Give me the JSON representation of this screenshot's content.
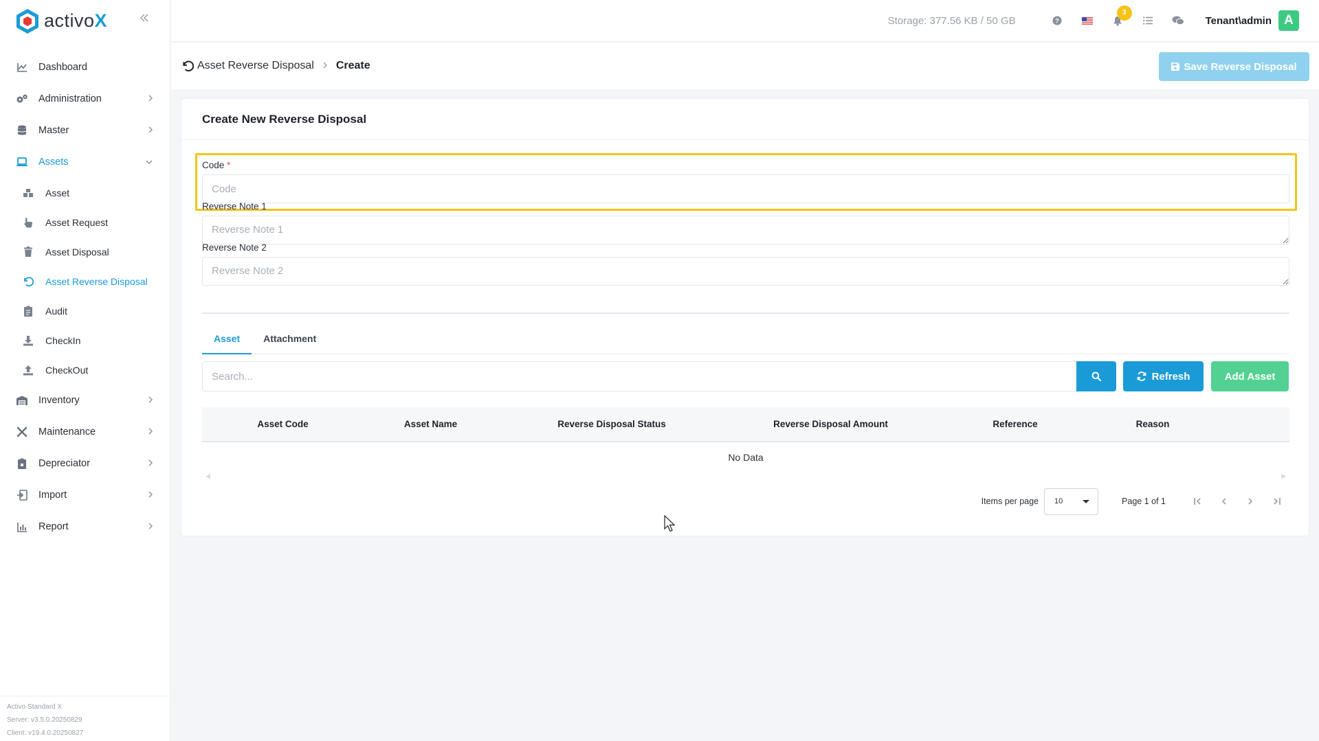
{
  "app": {
    "logo_text": "activo",
    "logo_x": "X",
    "version_lines": [
      "Activo Standard X",
      "Server: v3.5.0.20250829",
      "Client: v19.4.0.20250827"
    ]
  },
  "topbar": {
    "storage": "Storage: 377.56 KB / 50 GB",
    "notification_count": "3",
    "user": "Tenant\\admin",
    "avatar_letter": "A"
  },
  "sidebar": {
    "items": [
      {
        "label": "Dashboard",
        "icon": "chart-line-icon"
      },
      {
        "label": "Administration",
        "icon": "gears-icon"
      },
      {
        "label": "Master",
        "icon": "database-icon"
      },
      {
        "label": "Assets",
        "icon": "laptop-icon"
      },
      {
        "label": "Inventory",
        "icon": "warehouse-icon"
      },
      {
        "label": "Maintenance",
        "icon": "tools-icon"
      },
      {
        "label": "Depreciator",
        "icon": "clipboard-icon"
      },
      {
        "label": "Import",
        "icon": "import-icon"
      },
      {
        "label": "Report",
        "icon": "bar-chart-icon"
      }
    ],
    "asset_subitems": [
      {
        "label": "Asset",
        "icon": "boxes-icon"
      },
      {
        "label": "Asset Request",
        "icon": "hand-pointer-icon"
      },
      {
        "label": "Asset Disposal",
        "icon": "trash-icon"
      },
      {
        "label": "Asset Reverse Disposal",
        "icon": "undo-icon"
      },
      {
        "label": "Audit",
        "icon": "clipboard-list-icon"
      },
      {
        "label": "CheckIn",
        "icon": "download-icon"
      },
      {
        "label": "CheckOut",
        "icon": "upload-icon"
      }
    ]
  },
  "breadcrumb": {
    "parent": "Asset Reverse Disposal",
    "current": "Create",
    "save_label": "Save Reverse Disposal"
  },
  "form": {
    "title": "Create New Reverse Disposal",
    "code_label": "Code",
    "code_required": "*",
    "code_placeholder": "Code",
    "note1_label": "Reverse Note 1",
    "note1_placeholder": "Reverse Note 1",
    "note2_label": "Reverse Note 2",
    "note2_placeholder": "Reverse Note 2"
  },
  "tabs": [
    "Asset",
    "Attachment"
  ],
  "asset_table": {
    "search_placeholder": "Search...",
    "refresh_label": "Refresh",
    "add_label": "Add Asset",
    "columns": [
      "Asset Code",
      "Asset Name",
      "Reverse Disposal Status",
      "Reverse Disposal Amount",
      "Reference",
      "Reason"
    ],
    "empty_text": "No Data"
  },
  "pager": {
    "items_per_page_label": "Items per page",
    "items_per_page": "10",
    "range": "Page 1 of 1"
  },
  "colors": {
    "accent": "#1a9bd7",
    "success": "#53d192",
    "highlight": "#f3c419",
    "badge": "#f7c315"
  }
}
